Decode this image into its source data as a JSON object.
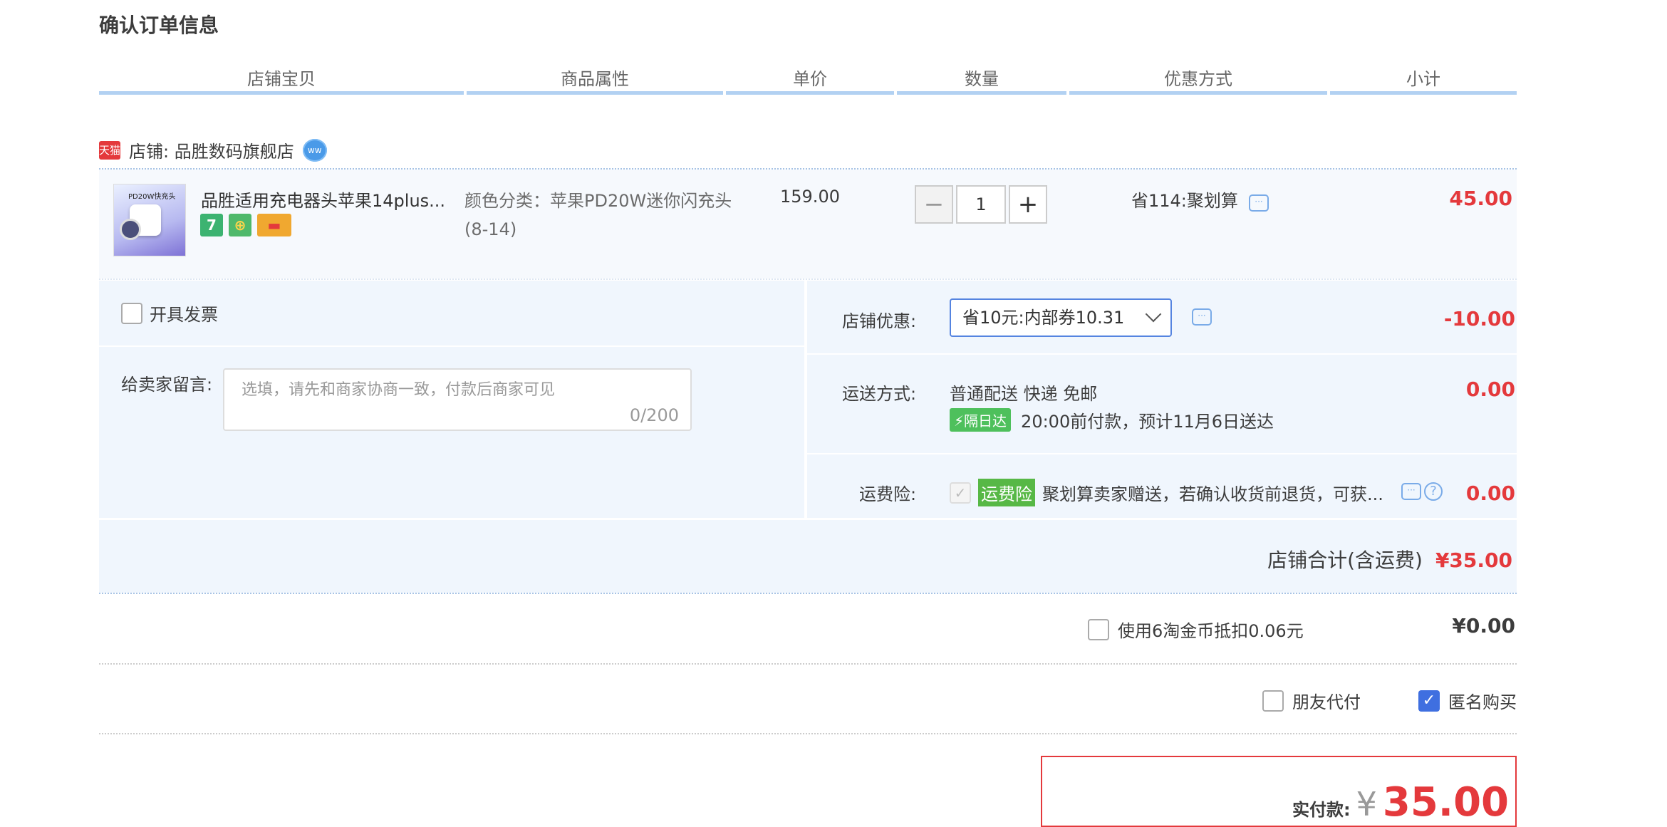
{
  "page_title": "确认订单信息",
  "columns": [
    "店铺宝贝",
    "商品属性",
    "单价",
    "数量",
    "优惠方式",
    "小计"
  ],
  "shop": {
    "logo_text": "天猫",
    "label": "店铺: 品胜数码旗舰店",
    "ww_text": "ww"
  },
  "item": {
    "name": "品胜适用充电器头苹果14plus...",
    "thumb_text": "PD20W快充头",
    "badges": [
      "7",
      "⊕",
      "▬"
    ],
    "attr": "颜色分类：苹果PD20W迷你闪充头(8-14)",
    "price": "159.00",
    "qty_minus": "−",
    "qty": "1",
    "qty_plus": "+",
    "discount": "省114:聚划算",
    "subtotal": "45.00"
  },
  "invoice": {
    "label": "开具发票"
  },
  "message": {
    "label": "给卖家留言:",
    "placeholder": "选填，请先和商家协商一致，付款后商家可见",
    "counter": "0/200"
  },
  "store_discount": {
    "label": "店铺优惠:",
    "selected": "省10元:内部券10.31",
    "amount": "-10.00"
  },
  "shipping": {
    "label": "运送方式:",
    "method": "普通配送 快递 免邮",
    "tag": "⚡隔日达",
    "eta": "20:00前付款，预计11月6日送达",
    "amount": "0.00"
  },
  "insurance": {
    "label": "运费险:",
    "tag": "运费险",
    "desc": "聚划算卖家赠送，若确认收货前退货，可获...",
    "amount": "0.00",
    "help": "?"
  },
  "shop_total": {
    "label": "店铺合计(含运费)",
    "amount": "¥35.00"
  },
  "taojinbi": {
    "label": "使用6淘金币抵扣0.06元",
    "amount": "¥0.00"
  },
  "options": {
    "friend_pay": "朋友代付",
    "anonymous": "匿名购买"
  },
  "pay": {
    "label": "实付款:",
    "currency": "¥",
    "amount": "35.00"
  },
  "colors": {
    "accent_red": "#e4393c",
    "header_line": "#b2d1f2",
    "panel_bg": "#f0f6fd",
    "select_border": "#5584e0"
  }
}
